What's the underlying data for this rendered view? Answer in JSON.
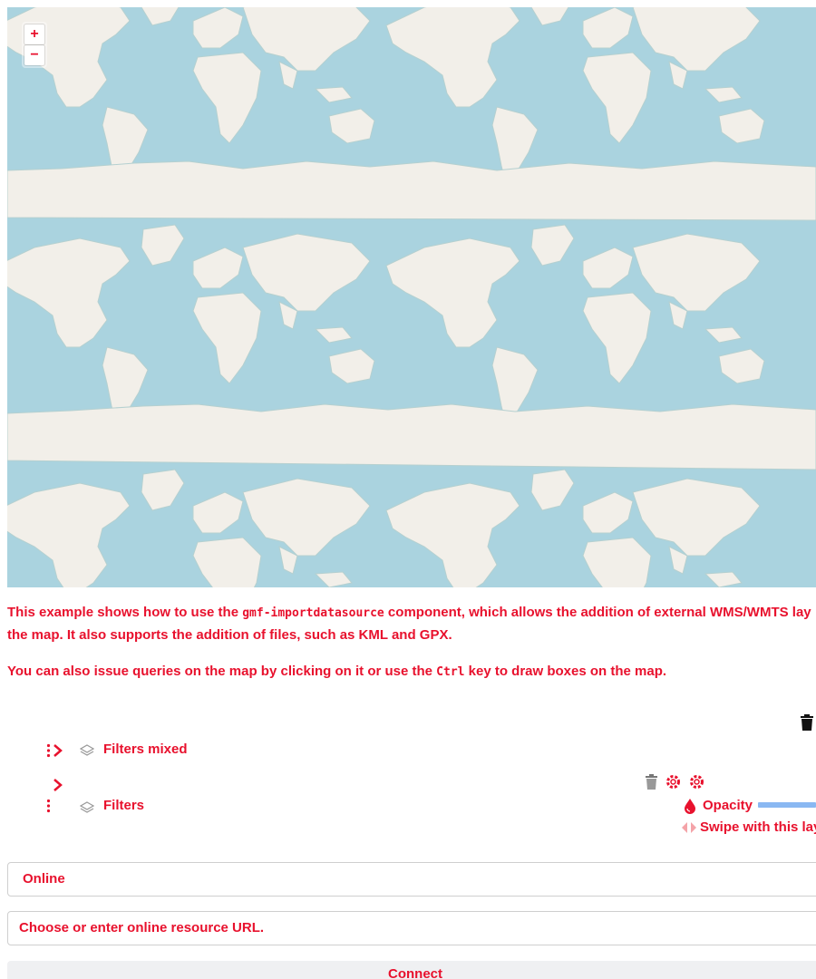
{
  "map": {
    "zoom_in_label": "+",
    "zoom_out_label": "−",
    "colors": {
      "water": "#aad3df",
      "land": "#f2efe9",
      "coast": "#b5d0d0"
    }
  },
  "description": {
    "p1_before": "This example shows how to use the ",
    "p1_code": "gmf-importdatasource",
    "p1_after": " component, which allows the addition of external WMS/WMTS lay",
    "p1_line2": "the map. It also supports the addition of files, such as KML and GPX.",
    "p2_before": "You can also issue queries on the map by clicking on it or use the ",
    "p2_code": "Ctrl",
    "p2_after": " key to draw boxes on the map."
  },
  "layertree": {
    "top_icon": "trash-icon",
    "groups": [
      {
        "name": "Filters mixed",
        "icons": [
          "drag-handle-icon",
          "expand-chevron-icon",
          "layers-icon"
        ]
      },
      {
        "name": "Filters",
        "icons": [
          "drag-handle-icon",
          "expand-chevron-icon",
          "layers-icon",
          "trash-icon",
          "settings-icon",
          "settings-icon"
        ],
        "opacity_label": "Opacity",
        "opacity_value": 1,
        "swipe_label": "Swipe with this lay"
      }
    ]
  },
  "import": {
    "type_selected": "Online",
    "url_placeholder": "Choose or enter online resource URL.",
    "connect_label": "Connect"
  },
  "colors": {
    "accent": "#e8112d",
    "slider": "#8ab8f2",
    "button_bg": "#eff0f2"
  }
}
